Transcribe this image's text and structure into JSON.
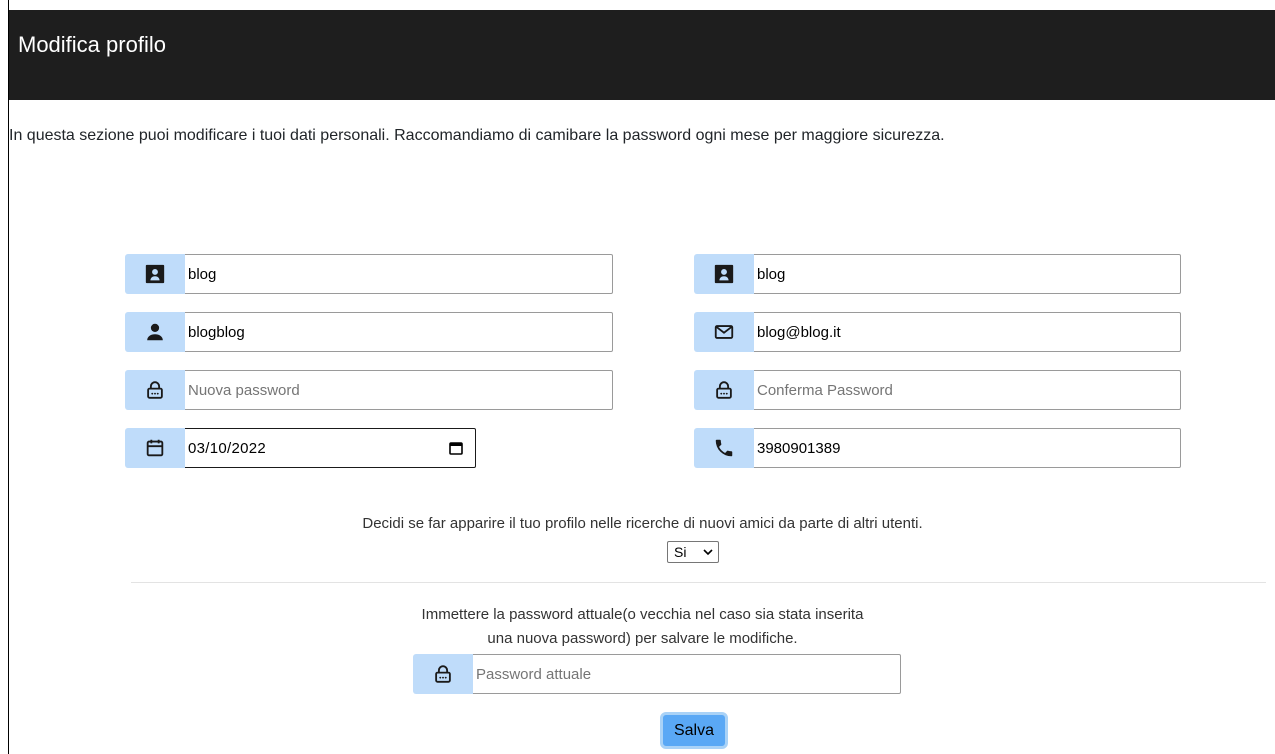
{
  "header": {
    "title": "Modifica profilo"
  },
  "intro": {
    "text": "In questa sezione puoi modificare i tuoi dati personali. Raccomandiamo di camibare la password ogni mese per maggiore sicurezza."
  },
  "form": {
    "first_name": {
      "value": "blog",
      "icon": "id-card-icon"
    },
    "last_name": {
      "value": "blog",
      "icon": "id-card-icon"
    },
    "username": {
      "value": "blogblog",
      "icon": "user-icon"
    },
    "email": {
      "value": "blog@blog.it",
      "icon": "envelope-icon"
    },
    "new_password": {
      "value": "",
      "placeholder": "Nuova password",
      "icon": "lock-icon"
    },
    "confirm_password": {
      "value": "",
      "placeholder": "Conferma Password",
      "icon": "lock-icon"
    },
    "birth_date": {
      "value": "03/10/2022",
      "icon": "calendar-icon"
    },
    "phone": {
      "value": "3980901389",
      "icon": "phone-icon"
    }
  },
  "privacy": {
    "text": "Decidi se far apparire il tuo profilo nelle ricerche di nuovi amici da parte di altri utenti.",
    "selected": "Si"
  },
  "confirm": {
    "line1": "Immettere la password attuale(o vecchia nel caso sia stata inserita",
    "line2": "una nuova password) per salvare le modifiche.",
    "password_placeholder": "Password attuale",
    "icon": "lock-icon"
  },
  "save": {
    "label": "Salva"
  },
  "colors": {
    "header_bg": "#1e1e1e",
    "addon_bg": "#bfdcfa",
    "button_bg": "#5aa8f5"
  }
}
